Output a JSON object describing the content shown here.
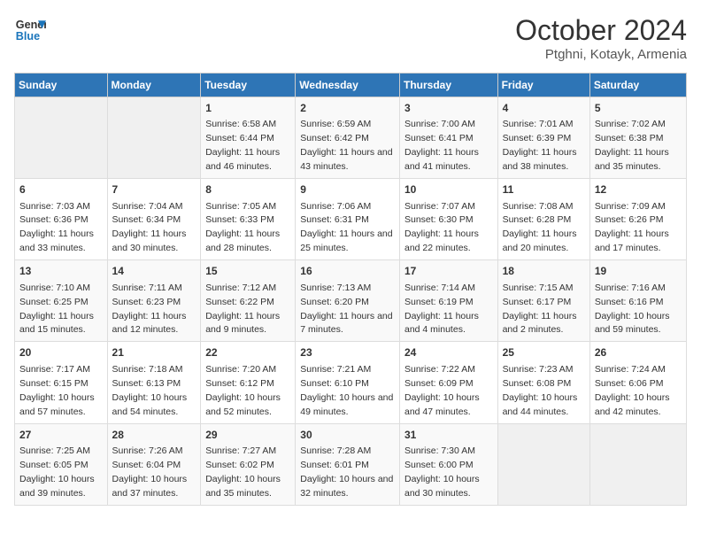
{
  "logo": {
    "line1": "General",
    "line2": "Blue"
  },
  "title": "October 2024",
  "location": "Ptghni, Kotayk, Armenia",
  "weekdays": [
    "Sunday",
    "Monday",
    "Tuesday",
    "Wednesday",
    "Thursday",
    "Friday",
    "Saturday"
  ],
  "weeks": [
    [
      {
        "day": "",
        "sunrise": "",
        "sunset": "",
        "daylight": "",
        "empty": true
      },
      {
        "day": "",
        "sunrise": "",
        "sunset": "",
        "daylight": "",
        "empty": true
      },
      {
        "day": "1",
        "sunrise": "Sunrise: 6:58 AM",
        "sunset": "Sunset: 6:44 PM",
        "daylight": "Daylight: 11 hours and 46 minutes."
      },
      {
        "day": "2",
        "sunrise": "Sunrise: 6:59 AM",
        "sunset": "Sunset: 6:42 PM",
        "daylight": "Daylight: 11 hours and 43 minutes."
      },
      {
        "day": "3",
        "sunrise": "Sunrise: 7:00 AM",
        "sunset": "Sunset: 6:41 PM",
        "daylight": "Daylight: 11 hours and 41 minutes."
      },
      {
        "day": "4",
        "sunrise": "Sunrise: 7:01 AM",
        "sunset": "Sunset: 6:39 PM",
        "daylight": "Daylight: 11 hours and 38 minutes."
      },
      {
        "day": "5",
        "sunrise": "Sunrise: 7:02 AM",
        "sunset": "Sunset: 6:38 PM",
        "daylight": "Daylight: 11 hours and 35 minutes."
      }
    ],
    [
      {
        "day": "6",
        "sunrise": "Sunrise: 7:03 AM",
        "sunset": "Sunset: 6:36 PM",
        "daylight": "Daylight: 11 hours and 33 minutes."
      },
      {
        "day": "7",
        "sunrise": "Sunrise: 7:04 AM",
        "sunset": "Sunset: 6:34 PM",
        "daylight": "Daylight: 11 hours and 30 minutes."
      },
      {
        "day": "8",
        "sunrise": "Sunrise: 7:05 AM",
        "sunset": "Sunset: 6:33 PM",
        "daylight": "Daylight: 11 hours and 28 minutes."
      },
      {
        "day": "9",
        "sunrise": "Sunrise: 7:06 AM",
        "sunset": "Sunset: 6:31 PM",
        "daylight": "Daylight: 11 hours and 25 minutes."
      },
      {
        "day": "10",
        "sunrise": "Sunrise: 7:07 AM",
        "sunset": "Sunset: 6:30 PM",
        "daylight": "Daylight: 11 hours and 22 minutes."
      },
      {
        "day": "11",
        "sunrise": "Sunrise: 7:08 AM",
        "sunset": "Sunset: 6:28 PM",
        "daylight": "Daylight: 11 hours and 20 minutes."
      },
      {
        "day": "12",
        "sunrise": "Sunrise: 7:09 AM",
        "sunset": "Sunset: 6:26 PM",
        "daylight": "Daylight: 11 hours and 17 minutes."
      }
    ],
    [
      {
        "day": "13",
        "sunrise": "Sunrise: 7:10 AM",
        "sunset": "Sunset: 6:25 PM",
        "daylight": "Daylight: 11 hours and 15 minutes."
      },
      {
        "day": "14",
        "sunrise": "Sunrise: 7:11 AM",
        "sunset": "Sunset: 6:23 PM",
        "daylight": "Daylight: 11 hours and 12 minutes."
      },
      {
        "day": "15",
        "sunrise": "Sunrise: 7:12 AM",
        "sunset": "Sunset: 6:22 PM",
        "daylight": "Daylight: 11 hours and 9 minutes."
      },
      {
        "day": "16",
        "sunrise": "Sunrise: 7:13 AM",
        "sunset": "Sunset: 6:20 PM",
        "daylight": "Daylight: 11 hours and 7 minutes."
      },
      {
        "day": "17",
        "sunrise": "Sunrise: 7:14 AM",
        "sunset": "Sunset: 6:19 PM",
        "daylight": "Daylight: 11 hours and 4 minutes."
      },
      {
        "day": "18",
        "sunrise": "Sunrise: 7:15 AM",
        "sunset": "Sunset: 6:17 PM",
        "daylight": "Daylight: 11 hours and 2 minutes."
      },
      {
        "day": "19",
        "sunrise": "Sunrise: 7:16 AM",
        "sunset": "Sunset: 6:16 PM",
        "daylight": "Daylight: 10 hours and 59 minutes."
      }
    ],
    [
      {
        "day": "20",
        "sunrise": "Sunrise: 7:17 AM",
        "sunset": "Sunset: 6:15 PM",
        "daylight": "Daylight: 10 hours and 57 minutes."
      },
      {
        "day": "21",
        "sunrise": "Sunrise: 7:18 AM",
        "sunset": "Sunset: 6:13 PM",
        "daylight": "Daylight: 10 hours and 54 minutes."
      },
      {
        "day": "22",
        "sunrise": "Sunrise: 7:20 AM",
        "sunset": "Sunset: 6:12 PM",
        "daylight": "Daylight: 10 hours and 52 minutes."
      },
      {
        "day": "23",
        "sunrise": "Sunrise: 7:21 AM",
        "sunset": "Sunset: 6:10 PM",
        "daylight": "Daylight: 10 hours and 49 minutes."
      },
      {
        "day": "24",
        "sunrise": "Sunrise: 7:22 AM",
        "sunset": "Sunset: 6:09 PM",
        "daylight": "Daylight: 10 hours and 47 minutes."
      },
      {
        "day": "25",
        "sunrise": "Sunrise: 7:23 AM",
        "sunset": "Sunset: 6:08 PM",
        "daylight": "Daylight: 10 hours and 44 minutes."
      },
      {
        "day": "26",
        "sunrise": "Sunrise: 7:24 AM",
        "sunset": "Sunset: 6:06 PM",
        "daylight": "Daylight: 10 hours and 42 minutes."
      }
    ],
    [
      {
        "day": "27",
        "sunrise": "Sunrise: 7:25 AM",
        "sunset": "Sunset: 6:05 PM",
        "daylight": "Daylight: 10 hours and 39 minutes."
      },
      {
        "day": "28",
        "sunrise": "Sunrise: 7:26 AM",
        "sunset": "Sunset: 6:04 PM",
        "daylight": "Daylight: 10 hours and 37 minutes."
      },
      {
        "day": "29",
        "sunrise": "Sunrise: 7:27 AM",
        "sunset": "Sunset: 6:02 PM",
        "daylight": "Daylight: 10 hours and 35 minutes."
      },
      {
        "day": "30",
        "sunrise": "Sunrise: 7:28 AM",
        "sunset": "Sunset: 6:01 PM",
        "daylight": "Daylight: 10 hours and 32 minutes."
      },
      {
        "day": "31",
        "sunrise": "Sunrise: 7:30 AM",
        "sunset": "Sunset: 6:00 PM",
        "daylight": "Daylight: 10 hours and 30 minutes."
      },
      {
        "day": "",
        "sunrise": "",
        "sunset": "",
        "daylight": "",
        "empty": true
      },
      {
        "day": "",
        "sunrise": "",
        "sunset": "",
        "daylight": "",
        "empty": true
      }
    ]
  ]
}
